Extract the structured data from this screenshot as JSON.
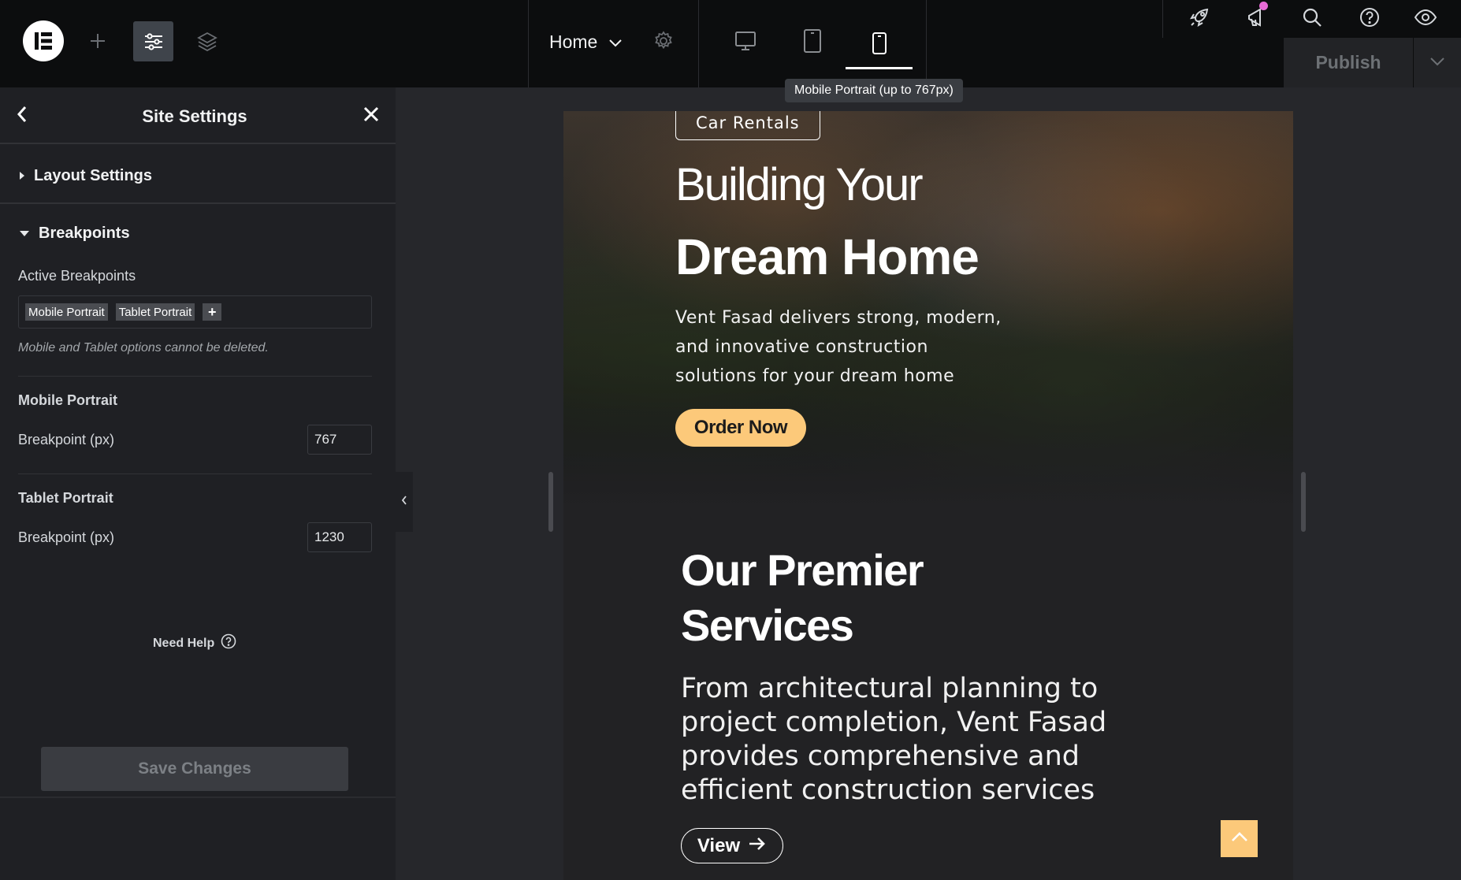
{
  "topbar": {
    "page_name": "Home",
    "publish_label": "Publish",
    "tooltip": "Mobile Portrait (up to 767px)"
  },
  "panel": {
    "title": "Site Settings",
    "layout_section": "Layout Settings",
    "breakpoints_section": "Breakpoints",
    "active_breakpoints_label": "Active Breakpoints",
    "active_breakpoints": [
      "Mobile Portrait",
      "Tablet Portrait"
    ],
    "add_tag": "+",
    "note": "Mobile and Tablet options cannot be deleted.",
    "mobile": {
      "title": "Mobile Portrait",
      "field_label": "Breakpoint (px)",
      "value": "767"
    },
    "tablet": {
      "title": "Tablet Portrait",
      "field_label": "Breakpoint (px)",
      "value": "1230"
    },
    "need_help": "Need Help",
    "save_label": "Save Changes"
  },
  "preview": {
    "tag": "Car Rentals",
    "hero_title_1": "Building Your",
    "hero_title_2": "Dream Home",
    "hero_text": "Vent Fasad delivers strong, modern, and innovative construction solutions for your dream home",
    "order_label": "Order Now",
    "services_title": "Our Premier Services",
    "services_text": "From architectural planning to project completion, Vent Fasad provides comprehensive and efficient construction services",
    "view_label": "View"
  },
  "colors": {
    "topbar_bg": "#0c0d0e",
    "panel_bg": "#1f2024",
    "canvas_bg": "#26272b",
    "accent_button": "#fcc97a",
    "notification_dot": "#e86bd6"
  },
  "icons": [
    "elementor-logo-icon",
    "plus-icon",
    "sliders-icon",
    "layers-icon",
    "chevron-down-icon",
    "gear-icon",
    "desktop-icon",
    "tablet-icon",
    "mobile-icon",
    "rocket-icon",
    "megaphone-icon",
    "search-icon",
    "help-icon",
    "eye-icon",
    "back-arrow-icon",
    "close-icon",
    "question-circle-icon",
    "arrow-right-icon",
    "chevron-up-icon"
  ]
}
